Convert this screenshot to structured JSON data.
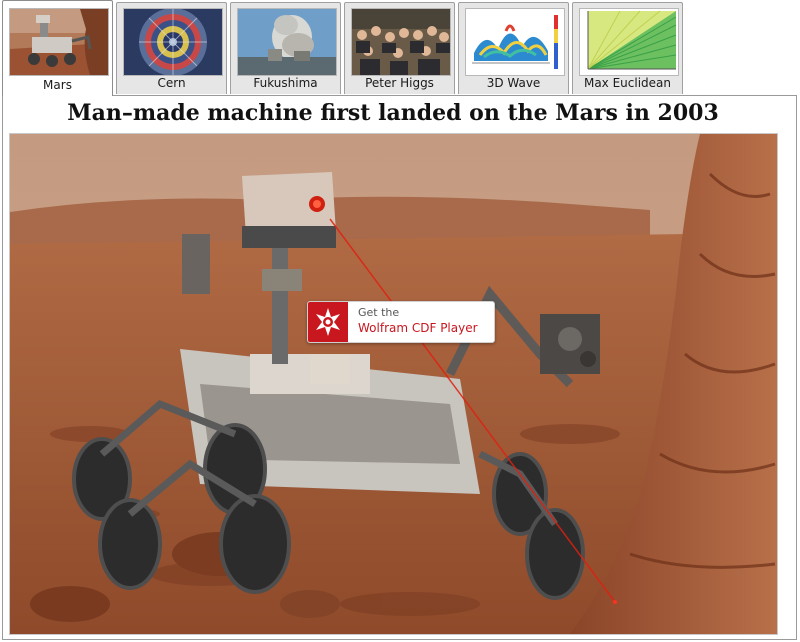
{
  "tabs": [
    {
      "label": "Mars",
      "active": true
    },
    {
      "label": "Cern",
      "active": false
    },
    {
      "label": "Fukushima",
      "active": false
    },
    {
      "label": "Peter Higgs",
      "active": false
    },
    {
      "label": "3D Wave",
      "active": false
    },
    {
      "label": "Max Euclidean",
      "active": false
    }
  ],
  "panel": {
    "caption": "Man–made machine first landed on the Mars in 2003"
  },
  "cdf_badge": {
    "line1": "Get the",
    "line2": "Wolfram CDF Player",
    "icon": "wolfram-spikey-icon"
  },
  "colors": {
    "cdf_red": "#c8171f",
    "mars_sky": "#c9a083",
    "mars_ground": "#a85a32"
  }
}
